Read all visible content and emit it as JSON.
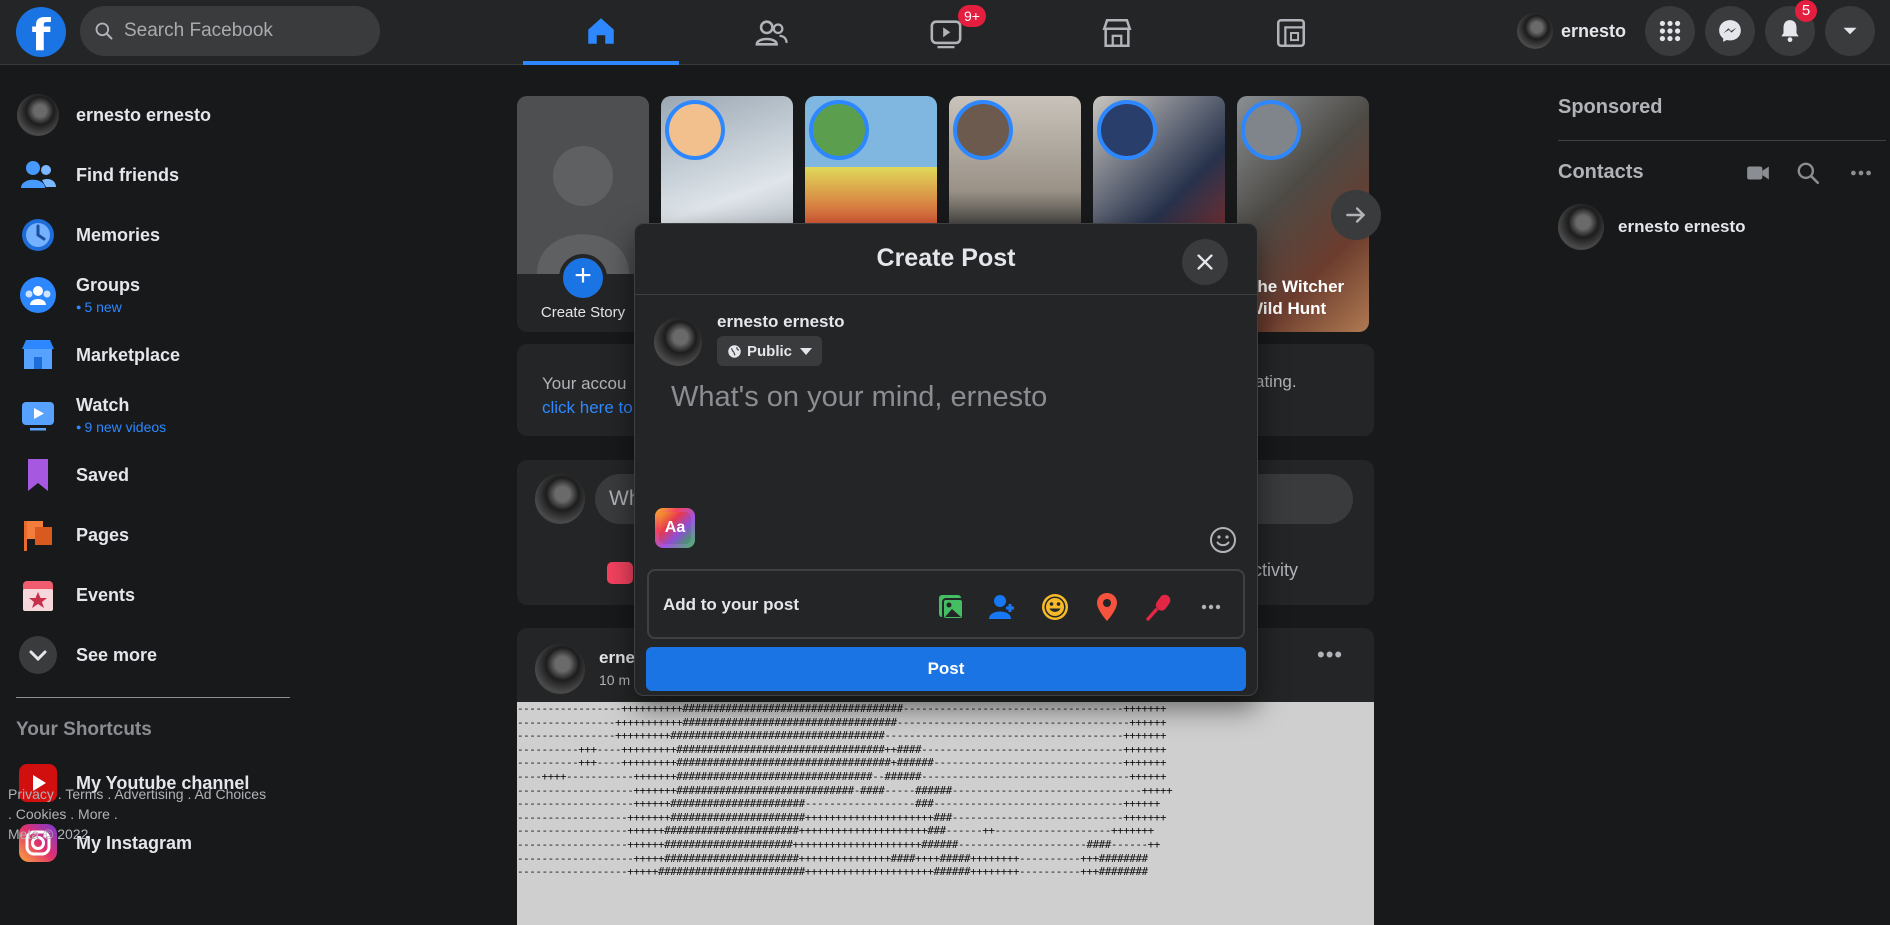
{
  "topbar": {
    "search_placeholder": "Search Facebook",
    "nav": [
      {
        "name": "home",
        "active": true
      },
      {
        "name": "friends"
      },
      {
        "name": "watch",
        "badge": "9+"
      },
      {
        "name": "marketplace"
      },
      {
        "name": "gaming"
      }
    ],
    "profile_name": "ernesto",
    "notifications_badge": "5",
    "accent": "#2d88ff",
    "badge_color": "#e41e3f"
  },
  "sidebar": {
    "profile": "ernesto ernesto",
    "items": [
      {
        "label": "Find friends",
        "icon": "friends-icon"
      },
      {
        "label": "Memories",
        "icon": "memories-clock-icon"
      },
      {
        "label": "Groups",
        "sub": "5 new",
        "icon": "groups-icon"
      },
      {
        "label": "Marketplace",
        "icon": "marketplace-icon"
      },
      {
        "label": "Watch",
        "sub": "9 new videos",
        "icon": "watch-icon"
      },
      {
        "label": "Saved",
        "icon": "bookmark-icon"
      },
      {
        "label": "Pages",
        "icon": "flag-icon"
      },
      {
        "label": "Events",
        "icon": "calendar-star-icon"
      },
      {
        "label": "See more",
        "icon": "chevron-down-icon"
      }
    ],
    "shortcuts_heading": "Your Shortcuts",
    "shortcuts": [
      {
        "label": "My Youtube channel",
        "icon": "youtube-icon"
      },
      {
        "label": "My Instagram",
        "icon": "instagram-icon"
      }
    ],
    "footer": {
      "line1": "Privacy . Terms . Advertising . Ad Choices",
      "line2": ". Cookies . More .",
      "line3": "Meta © 2022"
    }
  },
  "stories": {
    "create_label": "Create Story",
    "last_story_name_line1": "The Witcher",
    "last_story_name_line2": "Wild Hunt"
  },
  "notice": {
    "text_start": "Your accou",
    "link_start": "click here to",
    "text_end": "ating."
  },
  "composer": {
    "placeholder_fragment": "Wh",
    "activity_fragment": "ctivity"
  },
  "feed_post": {
    "author_fragment": "erne",
    "time_fragment": "10 m"
  },
  "right_rail": {
    "sponsored": "Sponsored",
    "contacts": "Contacts",
    "contact_list": [
      "ernesto ernesto"
    ]
  },
  "modal": {
    "title": "Create Post",
    "author": "ernesto ernesto",
    "privacy": "Public",
    "placeholder": "What's on your mind, ernesto",
    "text_format_label": "Aa",
    "add_to_post": "Add to your post",
    "add_icons": [
      "photo-video-icon",
      "tag-people-icon",
      "feeling-icon",
      "check-in-icon",
      "live-video-mic-icon",
      "more-options-icon"
    ],
    "post_button": "Post"
  },
  "ascii_art": [
    "-----------------++++++++++####################################------------------------------------+++++++",
    "----------------+++++++++++###################################--------------------------------------++++++",
    "----------------+++++++++###################################---------------------------------------+++++++",
    "----------+++----+++++++++##################################++####---------------------------------+++++++",
    "----------+++----+++++++++###################################+######-------------------------------+++++++",
    "----++++-----------+++++++################################--######----------------------------------++++++",
    "-------------------+++++++#############################-####-----######-------------------------------+++++",
    "-------------------++++++######################------------------###-------------------------------++++++",
    "------------------+++++++######################+++++++++++++++++++++###----------------------------+++++++",
    "------------------++++++######################+++++++++++++++++++++###------++-------------------+++++++",
    "------------------++++++#####################+++++++++++++++++++++######---------------------####------++",
    "-------------------+++++######################+++++++++++++++####++++#####++++++++----------+++########",
    "------------------+++++########################+++++++++++++++++++++######++++++++----------+++########"
  ]
}
